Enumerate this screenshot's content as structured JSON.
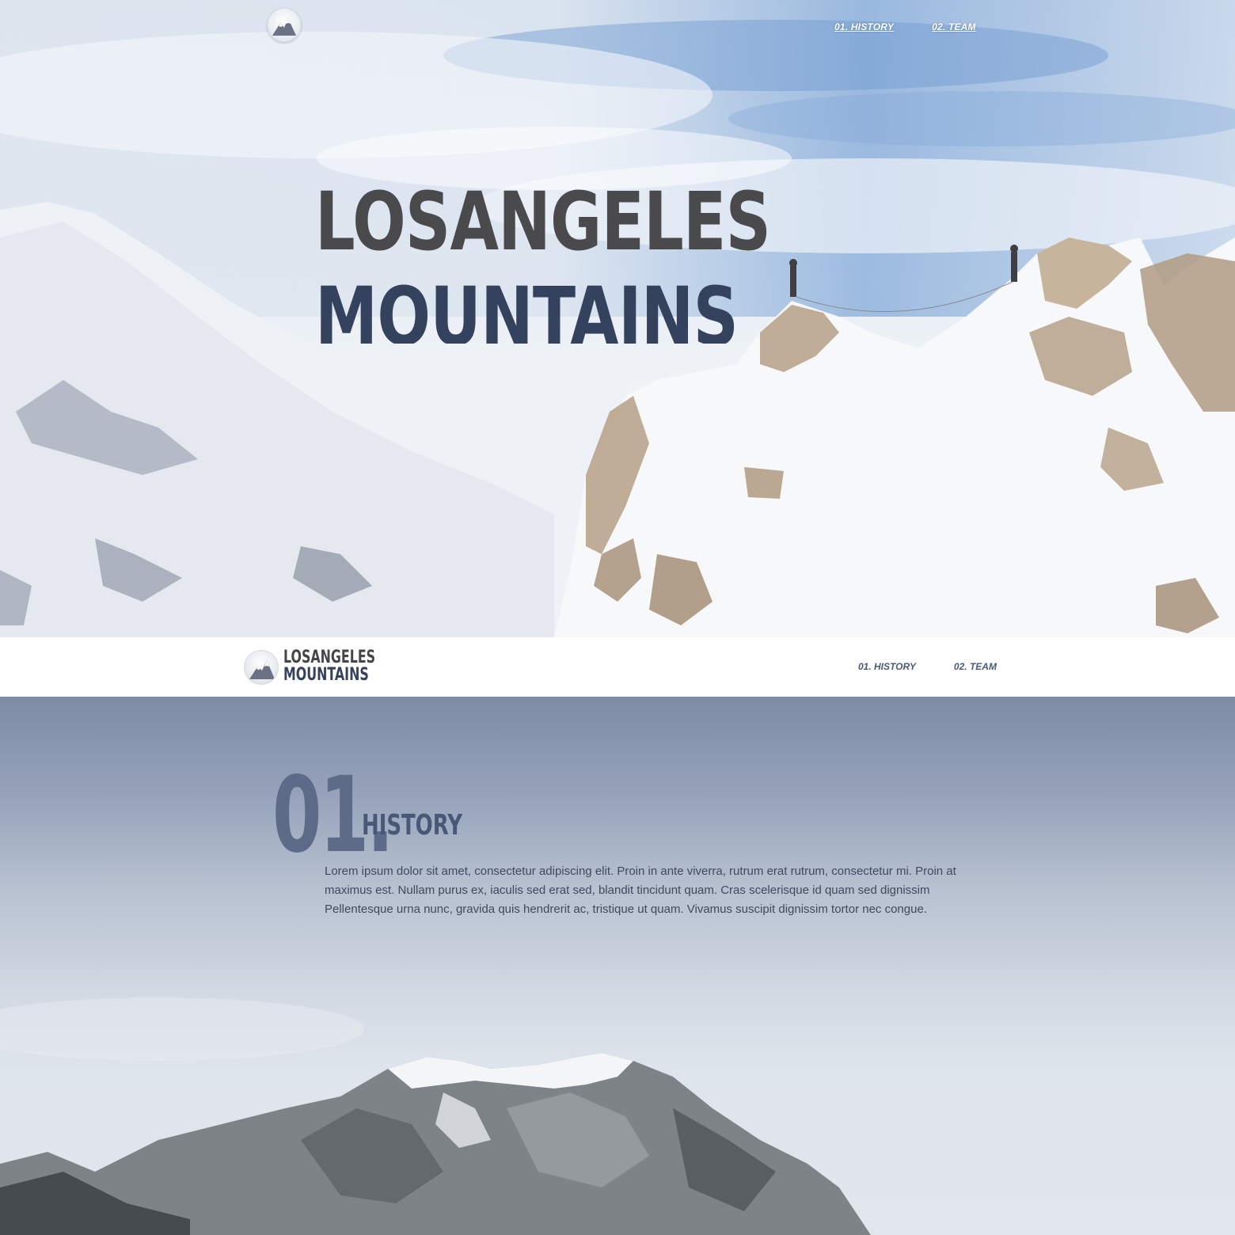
{
  "hero": {
    "nav": [
      {
        "label": "01. HISTORY"
      },
      {
        "label": "02. TEAM"
      }
    ],
    "title_line1": "LOSANGELES",
    "title_line2": "MOUNTAINS"
  },
  "navbar": {
    "brand_line1": "LOSANGELES",
    "brand_line2": "MOUNTAINS",
    "links": [
      {
        "label": "01. HISTORY"
      },
      {
        "label": "02. TEAM"
      }
    ]
  },
  "history": {
    "number": "01.",
    "title": "HISTORY",
    "body": "Lorem ipsum dolor sit amet, consectetur adipiscing elit. Proin in ante viverra, rutrum erat rutrum, consectetur mi. Proin at maximus est. Nullam purus ex, iaculis sed erat sed, blandit tincidunt quam. Cras scelerisque id quam sed dignissim Pellentesque urna nunc, gravida quis hendrerit ac, tristique ut quam. Vivamus suscipit dignissim tortor nec congue."
  },
  "colors": {
    "brand_dark": "#46464a",
    "brand_navy": "#34425e",
    "nav_link": "#4b5a78",
    "section_number": "#5d6b88"
  },
  "icons": {
    "logo": "mountain-logo-icon"
  }
}
